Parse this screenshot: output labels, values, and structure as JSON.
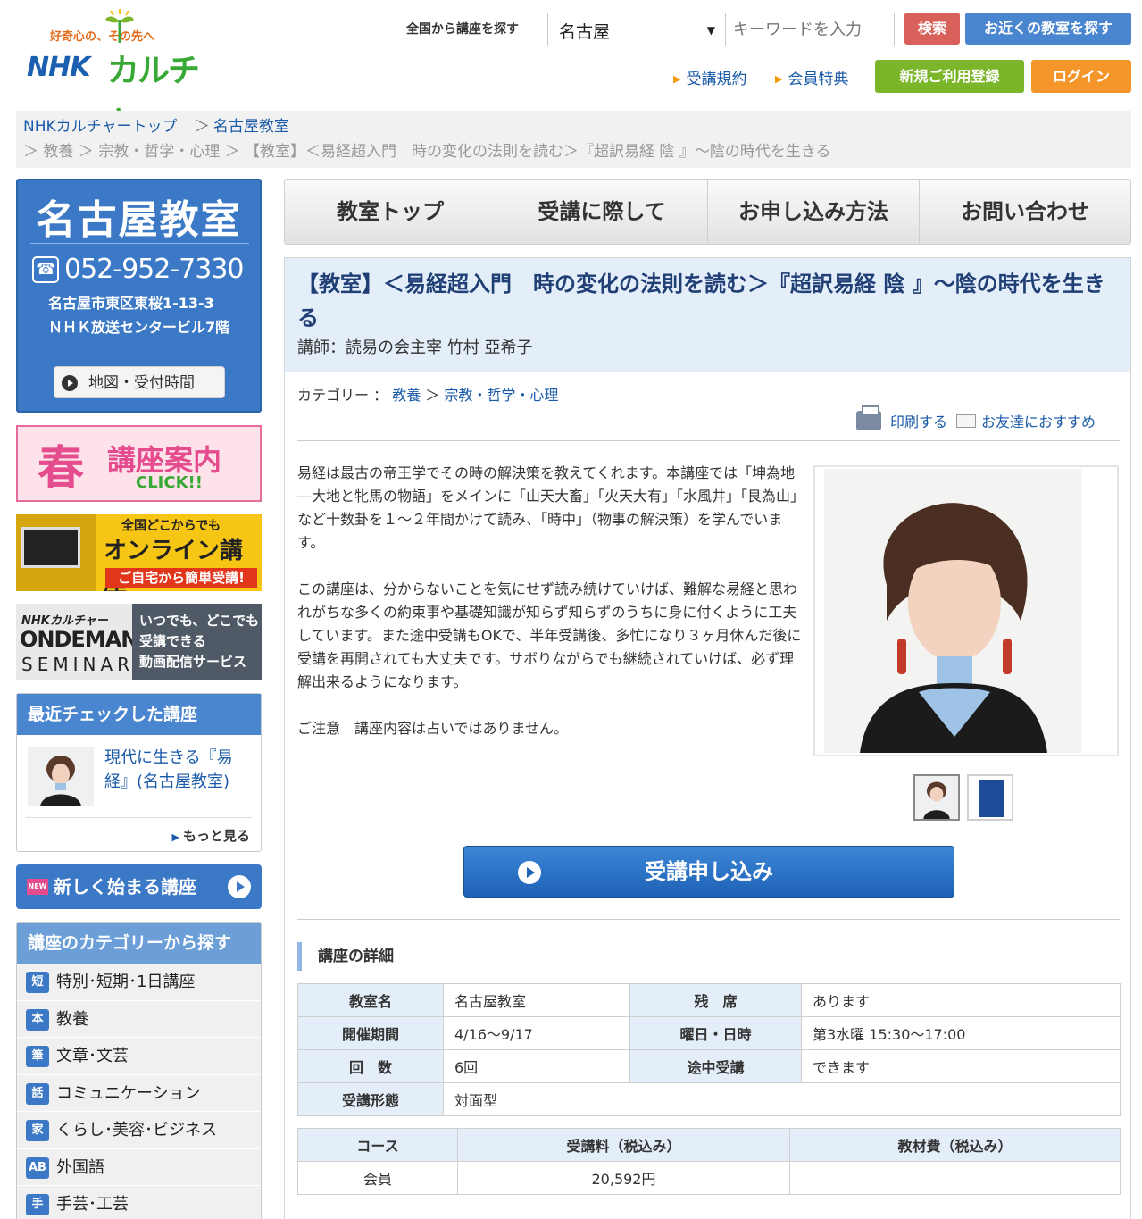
{
  "header": {
    "tagline": "好奇心の、その先へ",
    "logo_nhk": "NHK",
    "logo_culture": "カルチャー",
    "search_label": "全国から講座を探す",
    "location_selected": "名古屋",
    "keyword_placeholder": "キーワードを入力",
    "search_button": "検索",
    "nearby_button": "お近くの教室を探す",
    "link_terms": "受講規約",
    "link_benefits": "会員特典",
    "register_button": "新規ご利用登録",
    "login_button": "ログイン"
  },
  "breadcrumb": {
    "top": "NHKカルチャートップ",
    "classroom": "名古屋教室",
    "row2": "＞ 教養 ＞ 宗教・哲学・心理 ＞ 【教室】＜易経超入門　時の変化の法則を読む＞『超訳易経 陰 』～陰の時代を生きる"
  },
  "sidebar": {
    "class_name": "名古屋教室",
    "phone": "052-952-7330",
    "address1": "名古屋市東区東桜1-13-3",
    "address2": "ＮＨＫ放送センタービル7階",
    "map_button": "地図・受付時間",
    "spring_big": "春",
    "spring_mid": "講座案内",
    "spring_click": "CLICK!!",
    "online_t1": "全国どこからでも",
    "online_t2": "オンライン講座",
    "online_t3": "ご自宅から簡単受講!",
    "ondemand_t1": "NHKカルチャー",
    "ondemand_t2": "ONDEMAND",
    "ondemand_t3": "SEMINAR",
    "ondemand_right": [
      "いつでも、どこでも",
      "受講できる",
      "動画配信サービス"
    ],
    "recent_title": "最近チェックした講座",
    "recent_item": "現代に生きる『易経』(名古屋教室)",
    "recent_more": "もっと見る",
    "new_courses": "新しく始まる講座",
    "categories_title": "講座のカテゴリーから探す",
    "categories": [
      {
        "icon": "短",
        "label": "特別･短期･1日講座"
      },
      {
        "icon": "本",
        "label": "教養"
      },
      {
        "icon": "筆",
        "label": "文章･文芸"
      },
      {
        "icon": "話",
        "label": "コミュニケーション"
      },
      {
        "icon": "家",
        "label": "くらし･美容･ビジネス"
      },
      {
        "icon": "AB",
        "label": "外国語"
      },
      {
        "icon": "手",
        "label": "手芸･工芸"
      }
    ]
  },
  "nav": {
    "tabs": [
      "教室トップ",
      "受講に際して",
      "お申し込み方法",
      "お問い合わせ"
    ]
  },
  "course": {
    "title": "【教室】＜易経超入門　時の変化の法則を読む＞『超訳易経 陰 』～陰の時代を生きる",
    "teacher": "講師：読易の会主宰 竹村 亞希子",
    "category_label": "カテゴリー ：",
    "category_1": "教養",
    "category_2": "宗教・哲学・心理",
    "print": "印刷する",
    "recommend": "お友達におすすめ",
    "desc": [
      "易経は最古の帝王学でその時の解決策を教えてくれます。本講座では「坤為地―大地と牝馬の物語」をメインに「山天大畜」「火天大有」「水風井」「艮為山」など十数卦を１～２年間かけて読み、「時中」（物事の解決策）を学んでいます。",
      "この講座は、分からないことを気にせず読み続けていけば、難解な易経と思われがちな多くの約束事や基礎知識が知らず知らずのうちに身に付くように工夫しています。また途中受講もOKで、半年受講後、多忙になり３ヶ月休んだ後に受講を再開されても大丈夫です。サボりながらでも継続されていけば、必ず理解出来るようになります。",
      "ご注意　講座内容は占いではありません。"
    ],
    "apply_button": "受講申し込み",
    "details_title": "講座の詳細",
    "details": {
      "classroom_label": "教室名",
      "classroom": "名古屋教室",
      "seats_label": "残　席",
      "seats": "あります",
      "period_label": "開催期間",
      "period": "4/16～9/17",
      "schedule_label": "曜日・日時",
      "schedule": "第3水曜 15:30～17:00",
      "count_label": "回　数",
      "count": "6回",
      "midway_label": "途中受講",
      "midway": "できます",
      "format_label": "受講形態",
      "format": "対面型"
    },
    "fees": {
      "col_course": "コース",
      "col_fee": "受講料（税込み）",
      "col_material": "教材費（税込み）",
      "row_course": "会員",
      "row_fee": "20,592円",
      "row_material": ""
    }
  }
}
